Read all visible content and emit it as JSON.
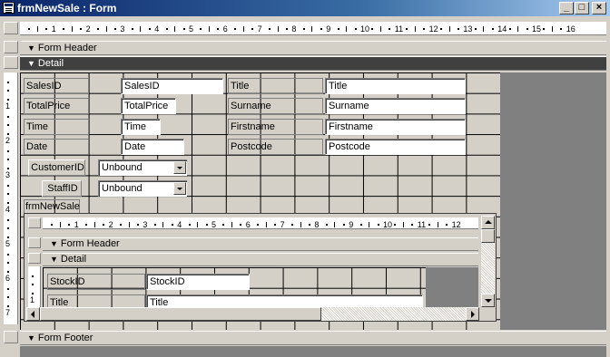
{
  "window": {
    "title": "frmNewSale : Form",
    "minimize_glyph": "_",
    "maximize_glyph": "□",
    "close_glyph": "×"
  },
  "ruler_numbers": [
    "1",
    "2",
    "3",
    "4",
    "5",
    "6",
    "7",
    "8",
    "9",
    "10",
    "11",
    "12",
    "13",
    "14",
    "15",
    "16"
  ],
  "vruler_numbers": [
    "1",
    "2",
    "3",
    "4",
    "5",
    "6",
    "7"
  ],
  "sections": {
    "form_header": "Form Header",
    "detail": "Detail",
    "form_footer": "Form Footer"
  },
  "detail": {
    "sales_id_label": "SalesID",
    "sales_id_value": "SalesID",
    "total_price_label": "TotalPrice",
    "total_price_value": "TotalPrice",
    "time_label": "Time",
    "time_value": "Time",
    "date_label": "Date",
    "date_value": "Date",
    "customer_id_label": "CustomerID",
    "customer_id_value": "Unbound",
    "staff_id_label": "StaffID",
    "staff_id_value": "Unbound",
    "title_label": "Title",
    "title_value": "Title",
    "surname_label": "Surname",
    "surname_value": "Surname",
    "firstname_label": "Firstname",
    "firstname_value": "Firstname",
    "postcode_label": "Postcode",
    "postcode_value": "Postcode",
    "subform_label": "frmNewSale"
  },
  "subform": {
    "ruler_numbers": [
      "1",
      "2",
      "3",
      "4",
      "5",
      "6",
      "7",
      "8",
      "9",
      "10",
      "11",
      "12"
    ],
    "vruler_numbers": [
      "1"
    ],
    "form_header": "Form Header",
    "detail": "Detail",
    "stock_id_label": "StockID",
    "stock_id_value": "StockID",
    "title_label": "Title",
    "title_value": "Title"
  },
  "icons": {
    "window_icon": "form-icon",
    "section_arrow": "section-arrow-icon"
  }
}
